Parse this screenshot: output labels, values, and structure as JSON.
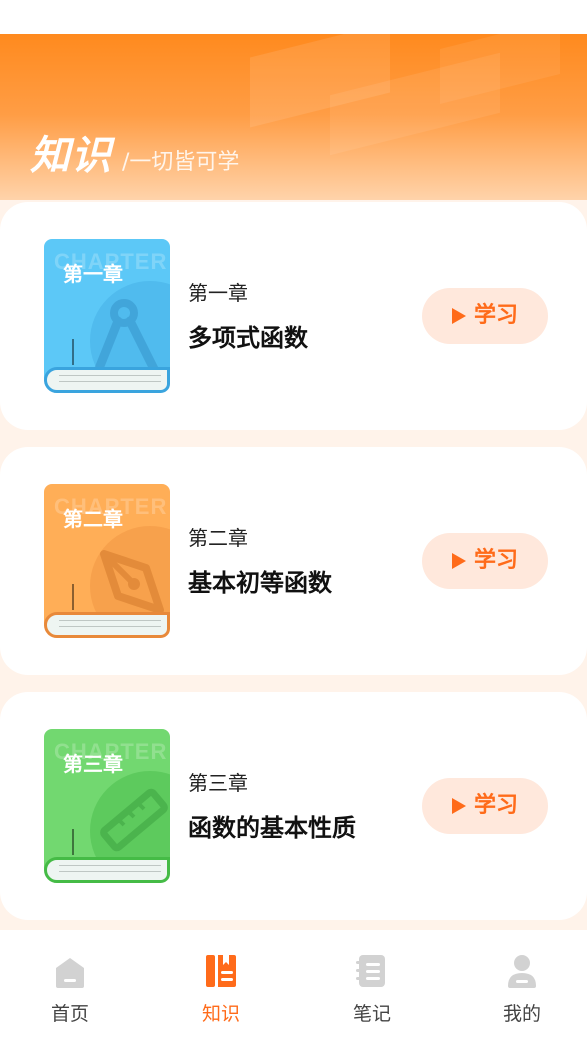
{
  "header": {
    "title": "知识",
    "subtitle": "/一切皆可学"
  },
  "chapters": [
    {
      "cover_label": "第一章",
      "watermark": "CHAPTER",
      "chapter_num": "第一章",
      "title": "多项式函数",
      "button_label": "学习",
      "cover_color": "#5cc8f7",
      "accent_color": "#3aa4de"
    },
    {
      "cover_label": "第二章",
      "watermark": "CHAPTER",
      "chapter_num": "第二章",
      "title": "基本初等函数",
      "button_label": "学习",
      "cover_color": "#ffae57",
      "accent_color": "#e8893a"
    },
    {
      "cover_label": "第三章",
      "watermark": "CHAPTER",
      "chapter_num": "第三章",
      "title": "函数的基本性质",
      "button_label": "学习",
      "cover_color": "#72d870",
      "accent_color": "#45bb46"
    }
  ],
  "tabbar": {
    "items": [
      {
        "label": "首页",
        "icon": "home-icon",
        "active": false
      },
      {
        "label": "知识",
        "icon": "book-icon",
        "active": true
      },
      {
        "label": "笔记",
        "icon": "notebook-icon",
        "active": false
      },
      {
        "label": "我的",
        "icon": "user-icon",
        "active": false
      }
    ]
  },
  "colors": {
    "accent": "#ff6b1a",
    "header_gradient_top": "#ff8a1e",
    "page_background": "#fff3ea",
    "tab_inactive": "#cfcfcf"
  }
}
